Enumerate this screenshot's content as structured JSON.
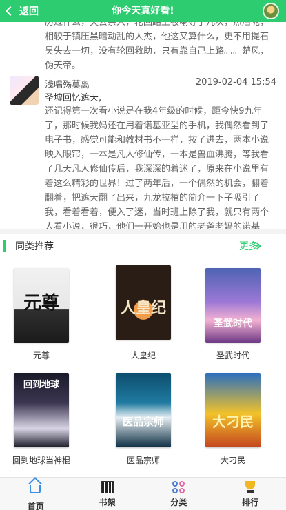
{
  "header": {
    "back_label": "返回",
    "title": "你今天真好看!"
  },
  "comments": {
    "prev_text": "历过什么，失去亲人，轮回路上被嘲辱了几次，然后呢，相较于镇压黑暗动乱的人杰，他这又算什么，更不用提石昊失去一切，没有轮回救助，只有靠自己上路。。。楚风，伪天帝。",
    "current": {
      "user": "浅唱殇莫离",
      "time": "2019-02-04 15:54",
      "title": "圣墟回忆遮天,",
      "body": "还记得第一次看小说是在我4年级的时候，距今快9九年了，那时候我妈还在用着诺基亚型的手机，我偶然看到了电子书，感觉可能和教材书不一样，按了进去，两本小说映入眼帘，一本是凡人修仙传，一本是兽血沸腾，等我看了几天凡人修仙传后，我深深的着迷了，原来在小说里有着这么精彩的世界！过了两年后，一个偶然的机会，翻着翻着，把遮天翻了出来，九龙拉棺的简介一下子吸引了我，看着看着，便入了迷，当时班上除了我，就只有两个人看小说，很巧，他们一开始也是用的老爸老妈的诺基亚，看的第一本小说也是凡人修仙传，我们一"
    }
  },
  "recommend": {
    "title": "同类推荐",
    "more_label": "更多",
    "books": [
      {
        "name": "元尊",
        "cover_text": "元尊"
      },
      {
        "name": "人皇纪",
        "cover_text": "人皇纪"
      },
      {
        "name": "圣武时代",
        "cover_text": "圣武时代"
      },
      {
        "name": "回到地球当神棍",
        "cover_text": "回到地球"
      },
      {
        "name": "医品宗师",
        "cover_text": "医品宗师"
      },
      {
        "name": "大刁民",
        "cover_text": "大刁民"
      }
    ]
  },
  "nav": {
    "items": [
      {
        "label": "首页",
        "icon": "home-icon"
      },
      {
        "label": "书架",
        "icon": "bookshelf-icon"
      },
      {
        "label": "分类",
        "icon": "category-icon"
      },
      {
        "label": "排行",
        "icon": "trophy-icon"
      }
    ]
  }
}
